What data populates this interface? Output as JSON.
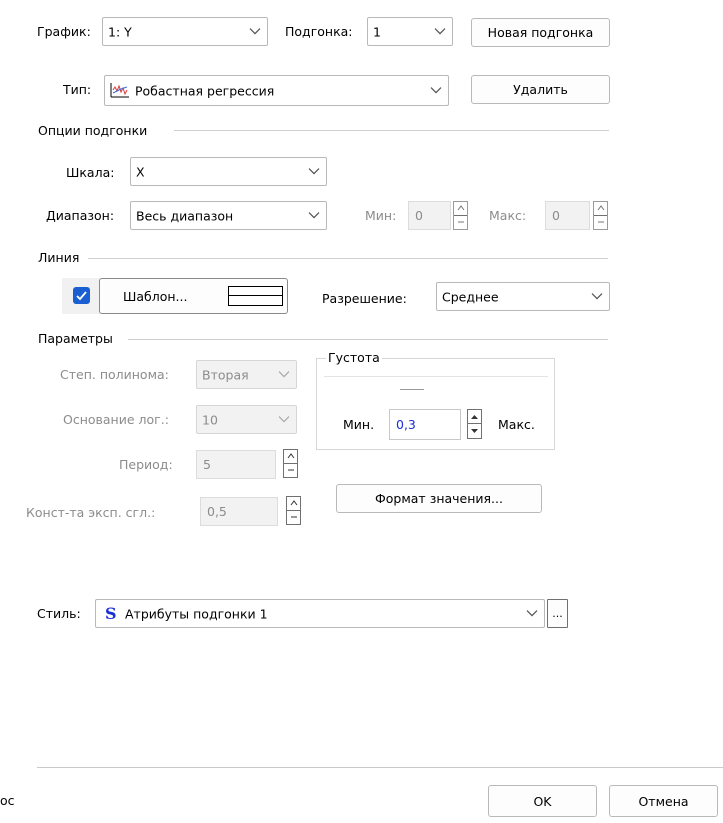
{
  "top": {
    "graph_label": "График:",
    "graph_value": "1: Y",
    "fit_label": "Подгонка:",
    "fit_value": "1",
    "new_fit_button": "Новая подгонка",
    "type_label": "Тип:",
    "type_value": "Робастная регрессия",
    "delete_button": "Удалить"
  },
  "fit_options": {
    "title": "Опции подгонки",
    "scale_label": "Шкала:",
    "scale_value": "X",
    "range_label": "Диапазон:",
    "range_value": "Весь диапазон",
    "min_label": "Мин:",
    "min_value": "0",
    "max_label": "Макс:",
    "max_value": "0"
  },
  "line": {
    "title": "Линия",
    "checked": true,
    "template_button": "Шаблон...",
    "resolution_label": "Разрешение:",
    "resolution_value": "Среднее"
  },
  "params": {
    "title": "Параметры",
    "poly_degree_label": "Степ. полинома:",
    "poly_degree_value": "Вторая",
    "log_base_label": "Основание лог.:",
    "log_base_value": "10",
    "period_label": "Период:",
    "period_value": "5",
    "exp_smooth_label": "Конст-та эксп. сгл.:",
    "exp_smooth_value": "0,5"
  },
  "density": {
    "title": "Густота",
    "min_label": "Мин.",
    "value": "0,3",
    "max_label": "Макс."
  },
  "format_value_button": "Формат значения...",
  "style": {
    "label": "Стиль:",
    "icon_letter": "S",
    "value": "Атрибуты подгонки 1",
    "more_button": "..."
  },
  "footer": {
    "left_fragment": "ос",
    "ok_button": "OK",
    "cancel_button": "Отмена"
  },
  "colors": {
    "accent": "#1a5fd1",
    "style_letter": "#1a2fd6"
  }
}
